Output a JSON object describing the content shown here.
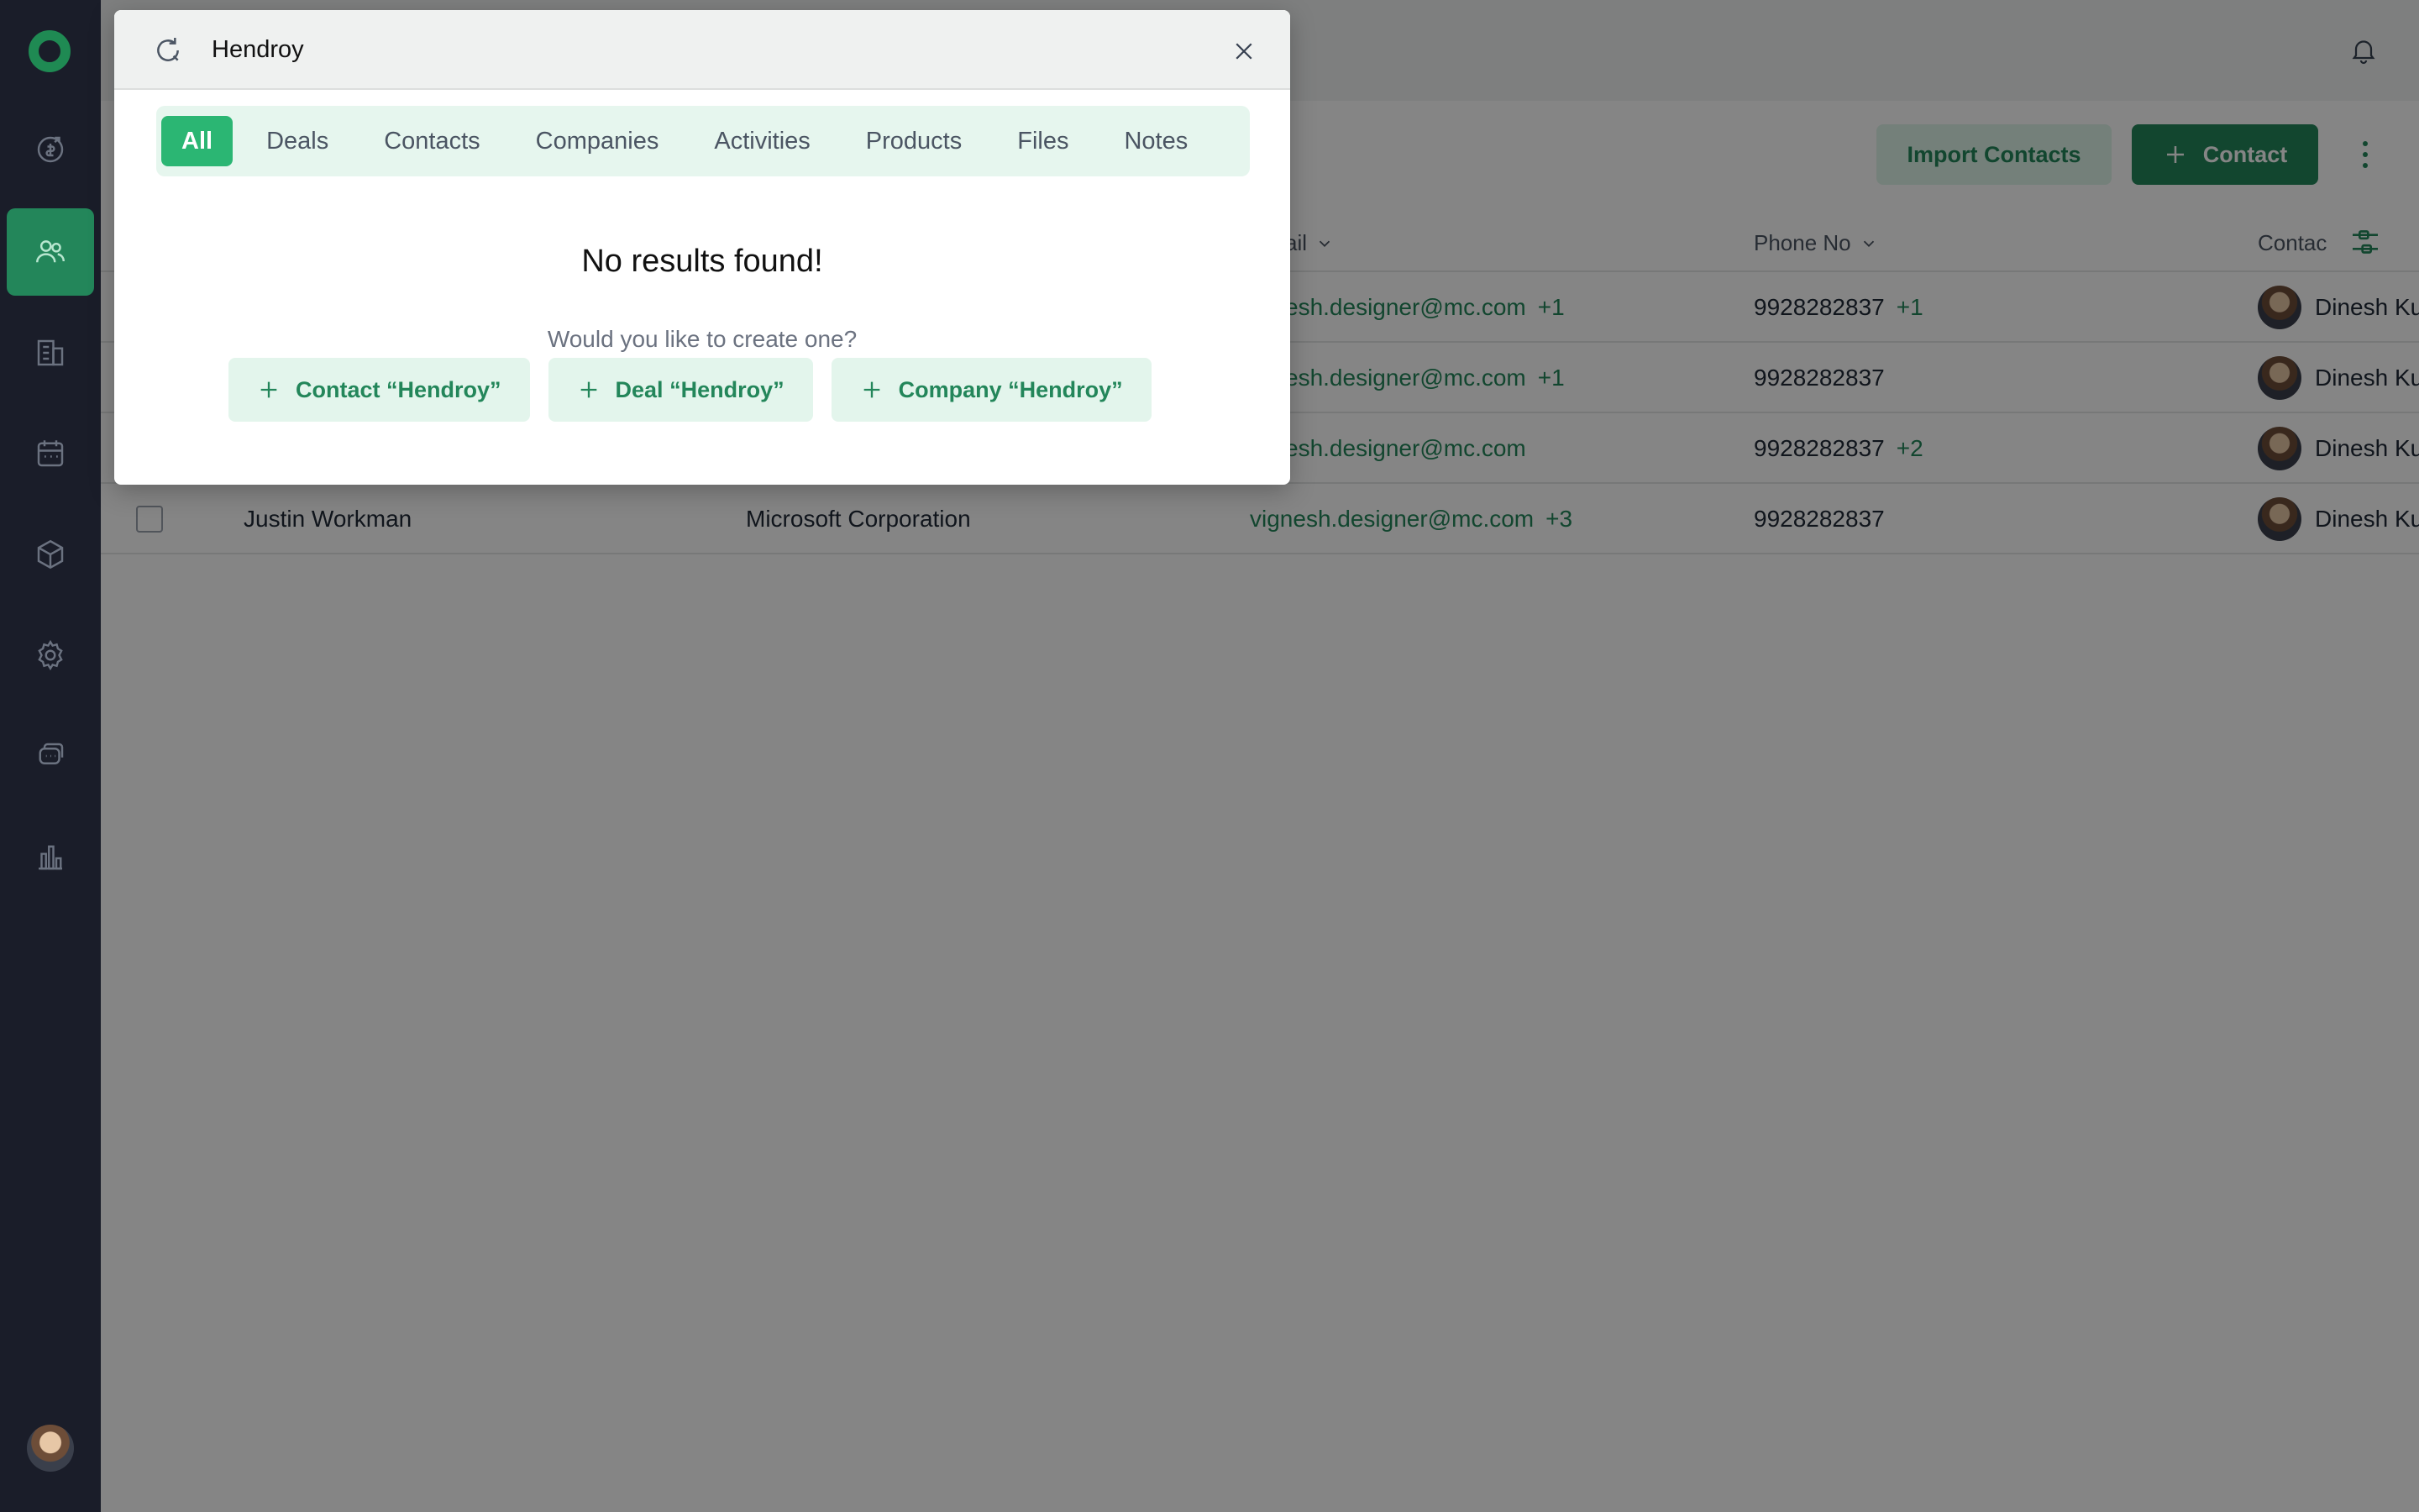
{
  "colors": {
    "accent": "#23865a",
    "accent_light": "#2bb673",
    "sidebar_bg": "#1a1d29",
    "tab_bg": "#e6f6ee"
  },
  "sidebar": {
    "items": [
      {
        "name": "deals",
        "icon": "dollar-refresh-icon"
      },
      {
        "name": "contacts",
        "icon": "users-icon",
        "active": true
      },
      {
        "name": "companies",
        "icon": "building-icon"
      },
      {
        "name": "activities",
        "icon": "calendar-icon"
      },
      {
        "name": "products",
        "icon": "box-icon"
      },
      {
        "name": "settings",
        "icon": "gear-icon"
      },
      {
        "name": "chat",
        "icon": "chat-icon"
      },
      {
        "name": "reports",
        "icon": "bar-chart-icon"
      }
    ]
  },
  "header": {
    "import_label": "Import Contacts",
    "add_contact_label": "Contact"
  },
  "table": {
    "columns": {
      "email": "ail",
      "phone": "Phone No",
      "owner": "Contac"
    },
    "rows": [
      {
        "name": "",
        "company": "",
        "email": "esh.designer@mc.com",
        "email_extra": "+1",
        "phone": "9928282837",
        "phone_extra": "+1",
        "owner": "Dinesh Ku"
      },
      {
        "name": "",
        "company": "",
        "email": "esh.designer@mc.com",
        "email_extra": "+1",
        "phone": "9928282837",
        "phone_extra": "",
        "owner": "Dinesh Ku"
      },
      {
        "name": "",
        "company": "",
        "email": "esh.designer@mc.com",
        "email_extra": "",
        "phone": "9928282837",
        "phone_extra": "+2",
        "owner": "Dinesh Ku"
      },
      {
        "name": "Justin Workman",
        "company": "Microsoft Corporation",
        "email": "vignesh.designer@mc.com",
        "email_extra": "+3",
        "phone": "9928282837",
        "phone_extra": "",
        "owner": "Dinesh Ku"
      }
    ]
  },
  "search": {
    "query": "Hendroy",
    "tabs": [
      "All",
      "Deals",
      "Contacts",
      "Companies",
      "Activities",
      "Products",
      "Files",
      "Notes"
    ],
    "active_tab": "All",
    "no_results": "No results found!",
    "create_prompt": "Would you like to create one?",
    "create_buttons": [
      {
        "label": "Contact “Hendroy”"
      },
      {
        "label": "Deal “Hendroy”"
      },
      {
        "label": "Company “Hendroy”"
      }
    ]
  }
}
